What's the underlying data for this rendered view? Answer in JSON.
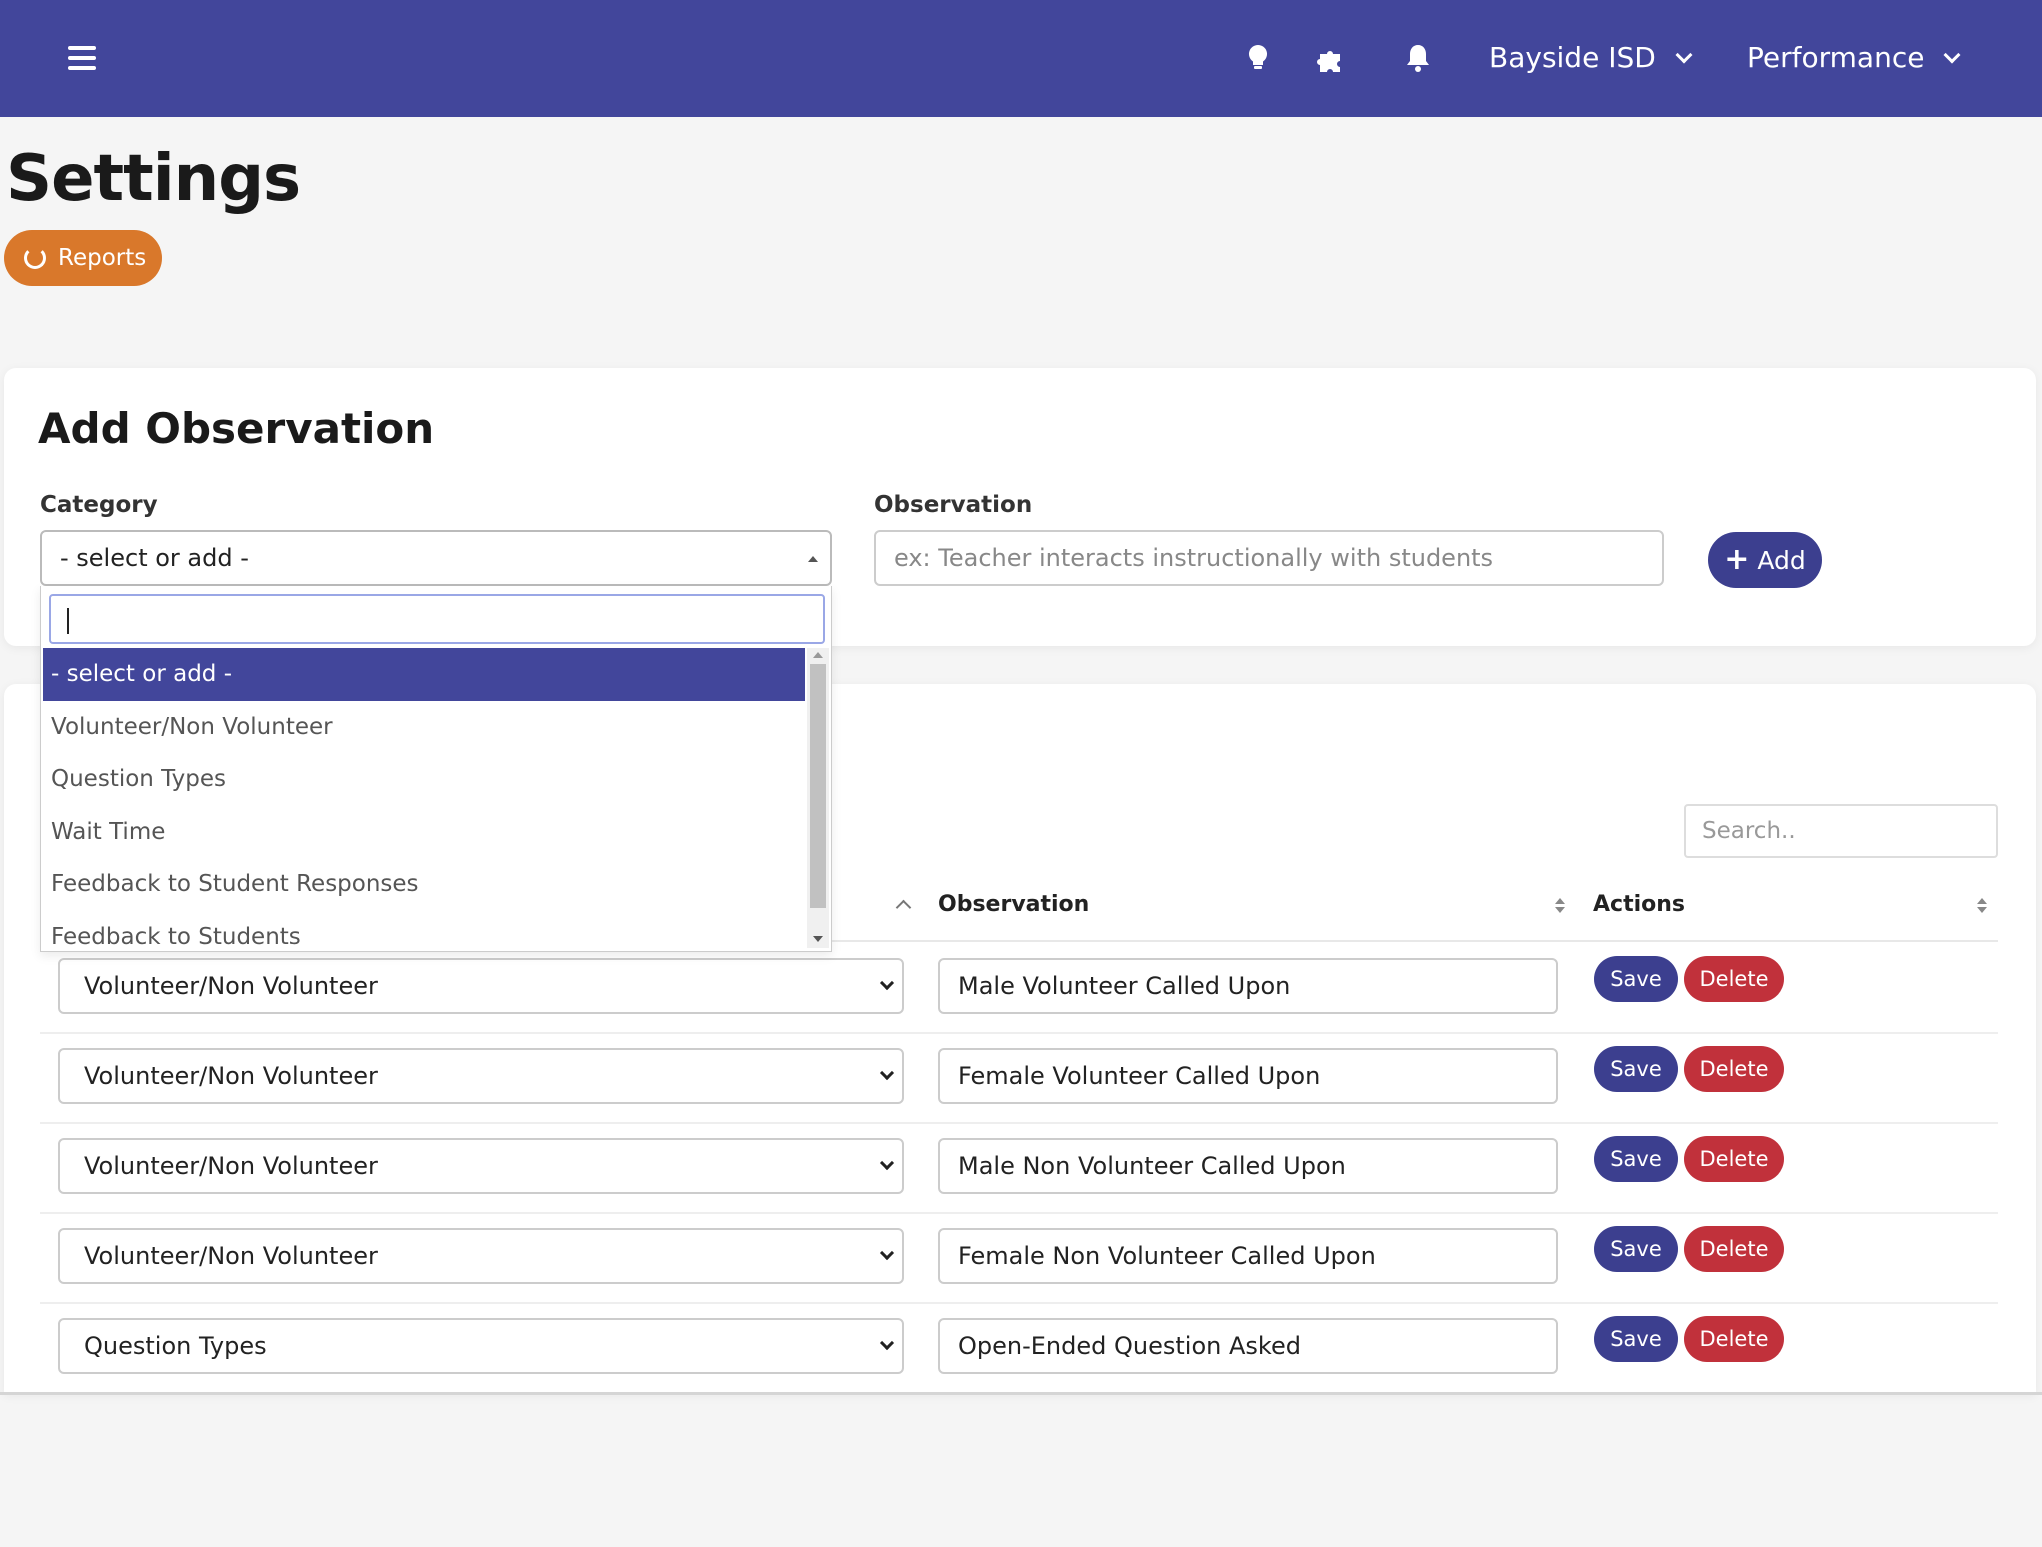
{
  "topbar": {
    "org_selector": "Bayside ISD",
    "module_selector": "Performance",
    "icons": [
      "menu-icon",
      "lightbulb-icon",
      "puzzle-icon",
      "bell-icon"
    ]
  },
  "page": {
    "title": "Settings",
    "reports_button": "Reports"
  },
  "add_observation": {
    "title": "Add Observation",
    "category_label": "Category",
    "category_value": "- select or add -",
    "observation_label": "Observation",
    "observation_placeholder": "ex: Teacher interacts instructionally with students",
    "add_button": "Add"
  },
  "category_dropdown": {
    "options": [
      "- select or add -",
      "Volunteer/Non Volunteer",
      "Question Types",
      "Wait Time",
      "Feedback to Student Responses",
      "Feedback to Students"
    ],
    "selected_index": 0
  },
  "table": {
    "search_placeholder": "Search..",
    "columns": [
      "Observation",
      "Actions"
    ],
    "save_label": "Save",
    "delete_label": "Delete",
    "rows": [
      {
        "category": "Volunteer/Non Volunteer",
        "observation": "Male Volunteer Called Upon"
      },
      {
        "category": "Volunteer/Non Volunteer",
        "observation": "Female Volunteer Called Upon"
      },
      {
        "category": "Volunteer/Non Volunteer",
        "observation": "Male Non Volunteer Called Upon"
      },
      {
        "category": "Volunteer/Non Volunteer",
        "observation": "Female Non Volunteer Called Upon"
      },
      {
        "category": "Question Types",
        "observation": "Open-Ended Question Asked"
      }
    ]
  },
  "colors": {
    "primary": "#42469b",
    "accent_orange": "#d9782b",
    "danger": "#c1313b"
  }
}
